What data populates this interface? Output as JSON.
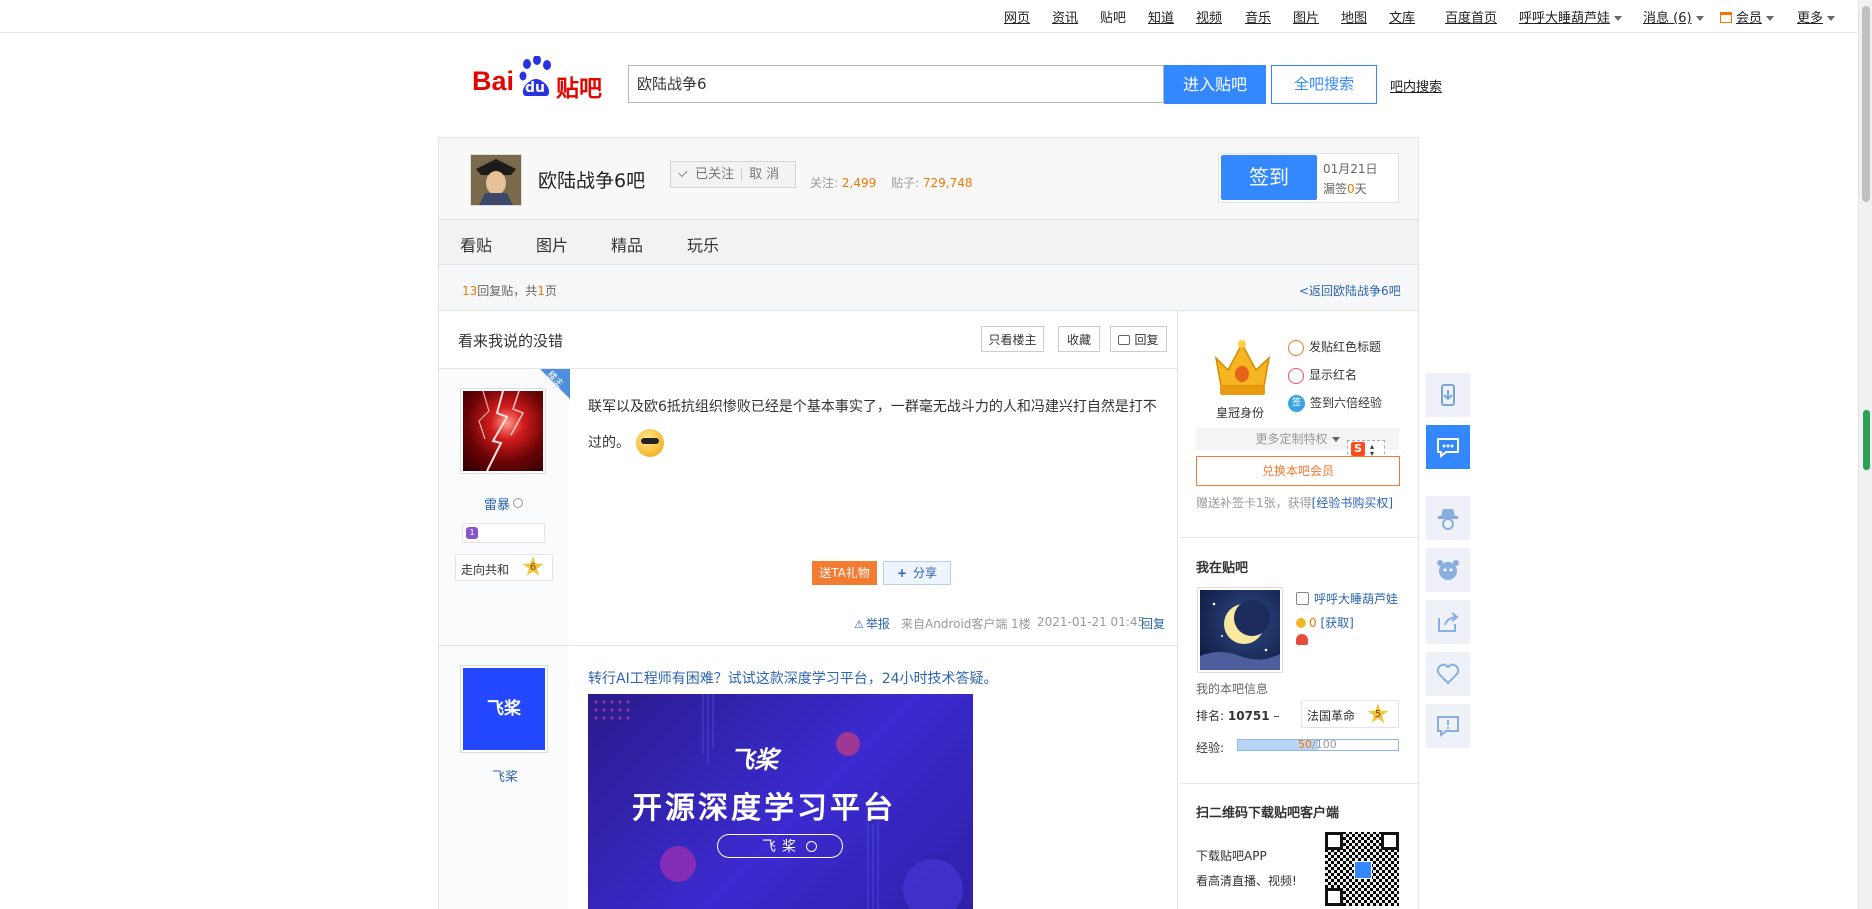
{
  "topnav": {
    "items": [
      "网页",
      "资讯",
      "贴吧",
      "知道",
      "视频",
      "音乐",
      "图片",
      "地图",
      "文库"
    ],
    "home": "百度首页",
    "user": "呼呼大睡葫芦娃",
    "messages": "消息 (6)",
    "vip": "会员",
    "more": "更多"
  },
  "header": {
    "logo_text": "Bai",
    "logo_du": "du",
    "logo_tieba": "贴吧",
    "search_value": "欧陆战争6",
    "enter_button": "进入贴吧",
    "all_search_button": "全吧搜索",
    "inbar_search": "吧内搜索"
  },
  "forum": {
    "name": "欧陆战争6吧",
    "followed": "已关注",
    "cancel": "取 消",
    "follow_label": "关注:",
    "follow_count": "2,499",
    "posts_label": "贴子:",
    "posts_count": "729,748",
    "signin": "签到",
    "date": "01月21日",
    "miss_prefix": "漏签",
    "miss_count": "0",
    "miss_suffix": "天"
  },
  "tabs": [
    "看贴",
    "图片",
    "精品",
    "玩乐"
  ],
  "thread_meta": {
    "reply_num": "13",
    "reply_text": "回复贴，共",
    "page_num": "1",
    "page_text": "页",
    "back": "<返回欧陆战争6吧"
  },
  "thread": {
    "title": "看来我说的没错",
    "only_op": "只看楼主",
    "collect": "收藏",
    "reply": "回复"
  },
  "post1": {
    "op_tag": "楼主",
    "username": "雷暴",
    "honor": "走向共和",
    "honor_level": "6",
    "level_icon": "1",
    "content": "联军以及欧6抵抗组织惨败已经是个基本事实了，一群毫无战斗力的人和冯建兴打自然是打不过的。",
    "gift": "送TA礼物",
    "share": "分享",
    "report": "举报",
    "source": "来自Android客户端",
    "floor": "1楼",
    "time": "2021-01-21 01:45",
    "reply": "回复"
  },
  "post2": {
    "username": "飞桨",
    "avatar_text": "飞桨",
    "ad_link": "转行AI工程师有困难？试试这款深度学习平台，24小时技术答疑。",
    "ad_logo": "飞桨",
    "ad_headline": "开源深度学习平台",
    "ad_search": "飞桨"
  },
  "sidebar": {
    "crown_label": "皇冠身份",
    "privileges": [
      "发贴红色标题",
      "显示红名",
      "签到六倍经验"
    ],
    "more_privileges": "更多定制特权",
    "vip_button": "兑换本吧会员",
    "gift_text": "赠送补签卡1张，获得",
    "gift_link": "[经验书购买权]",
    "mine_title": "我在贴吧",
    "mine_name": "呼呼大睡葫芦娃",
    "coins": "0",
    "get": "[获取]",
    "bar_info": "我的本吧信息",
    "rank_label": "排名:",
    "rank": "10751",
    "rank_trend": "–",
    "honor": "法国革命",
    "honor_level": "5",
    "exp_label": "经验:",
    "exp_current": 50,
    "exp_total": 100,
    "exp_current_text": "50",
    "exp_total_text": "/100",
    "qr_title": "扫二维码下载贴吧客户端",
    "qr_line1": "下载贴吧APP",
    "qr_line2": "看高清直播、视频!"
  },
  "float_tools": [
    "download-icon",
    "chat-icon",
    "hat-icon",
    "face-icon",
    "share-icon",
    "heart-icon",
    "report-icon"
  ],
  "colors": {
    "accent": "#3388ff",
    "orange": "#f07800",
    "link": "#2d64b3"
  }
}
